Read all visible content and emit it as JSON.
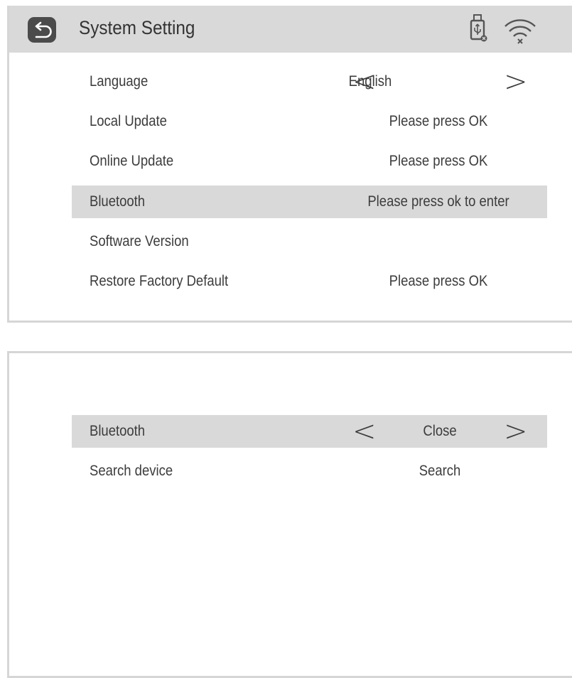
{
  "header": {
    "title": "System Setting",
    "back_icon": "back-arrow-icon",
    "usb_icon": "usb-drive-icon",
    "wifi_icon": "wifi-disconnected-icon"
  },
  "settings": {
    "items": [
      {
        "label": "Language",
        "value": "English",
        "arrows": true
      },
      {
        "label": "Local Update",
        "value": "Please press OK"
      },
      {
        "label": "Online Update",
        "value": "Please press OK"
      },
      {
        "label": "Bluetooth",
        "value": "Please press ok to enter",
        "selected": true
      },
      {
        "label": "Software Version",
        "value": ""
      },
      {
        "label": "Restore Factory Default",
        "value": "Please press OK"
      }
    ]
  },
  "bluetooth": {
    "items": [
      {
        "label": "Bluetooth",
        "value": "Close",
        "arrows": true,
        "selected": true
      },
      {
        "label": "Search device",
        "value": "Search"
      }
    ]
  },
  "glyphs": {
    "left": "<",
    "right": ">"
  },
  "colors": {
    "header_bg": "#d9d9d9",
    "selected_bg": "#d9d9d9",
    "icon_dark": "#4b4b4b"
  }
}
